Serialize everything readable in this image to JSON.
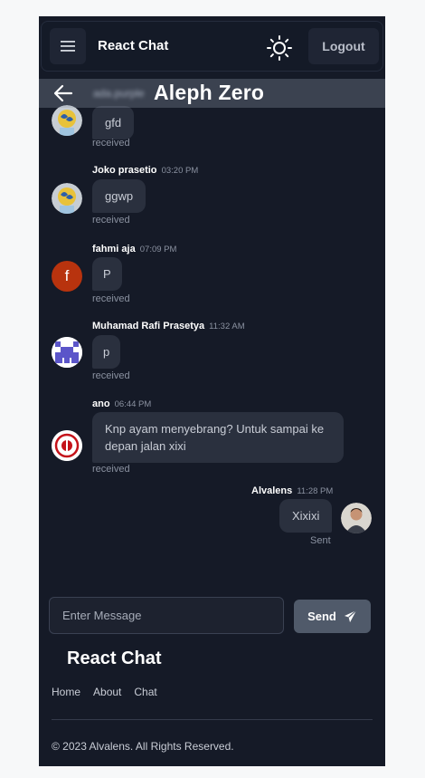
{
  "navbar": {
    "brand": "React Chat",
    "logout_label": "Logout",
    "menu_icon": "hamburger-icon",
    "theme_icon": "sun-icon"
  },
  "room": {
    "subtitle": "ada.purple",
    "title": "Aleph Zero",
    "back_icon": "arrow-left-icon"
  },
  "messages": [
    {
      "sender": "",
      "time": "",
      "text": "gfd",
      "status": "received",
      "avatar": "cartoon-avatar"
    },
    {
      "sender": "Joko prasetio",
      "time": "03:20 PM",
      "text": "ggwp",
      "status": "received",
      "avatar": "cartoon-avatar"
    },
    {
      "sender": "fahmi aja",
      "time": "07:09 PM",
      "text": "P",
      "status": "received",
      "avatar": "letter-avatar",
      "avatar_letter": "f"
    },
    {
      "sender": "Muhamad Rafi Prasetya",
      "time": "11:32 AM",
      "text": "p",
      "status": "received",
      "avatar": "pixel-avatar"
    },
    {
      "sender": "ano",
      "time": "06:44 PM",
      "text": "Knp ayam menyebrang? Untuk sampai ke depan jalan xixi",
      "status": "received",
      "avatar": "logo-avatar"
    },
    {
      "sender": "Alvalens",
      "time": "11:28 PM",
      "text": "Xixixi",
      "status": "Sent",
      "avatar": "photo-avatar"
    }
  ],
  "composer": {
    "placeholder": "Enter Message",
    "send_label": "Send",
    "send_icon": "paper-plane-icon"
  },
  "footer": {
    "title": "React Chat",
    "links": [
      "Home",
      "About",
      "Chat"
    ],
    "copyright": "© 2023 Alvalens. All Rights Reserved."
  },
  "colors": {
    "background": "#151a27",
    "bubble": "#2a303e",
    "send_button": "#505a6a",
    "page": "#f7f8f9"
  }
}
